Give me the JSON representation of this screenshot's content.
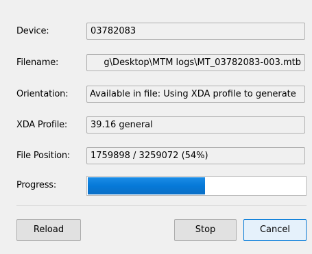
{
  "fields": {
    "device": {
      "label": "Device:",
      "value": "03782083"
    },
    "filename": {
      "label": "Filename:",
      "value": "g\\Desktop\\MTM logs\\MT_03782083-003.mtb"
    },
    "orientation": {
      "label": "Orientation:",
      "value": "Available in file: Using XDA profile to generate"
    },
    "xda_profile": {
      "label": "XDA Profile:",
      "value": "39.16 general"
    },
    "file_position": {
      "label": "File Position:",
      "value": "1759898 / 3259072 (54%)"
    }
  },
  "progress": {
    "label": "Progress:",
    "fraction": 0.54,
    "color": "#0679d8"
  },
  "buttons": {
    "reload": "Reload",
    "stop": "Stop",
    "cancel": "Cancel"
  }
}
